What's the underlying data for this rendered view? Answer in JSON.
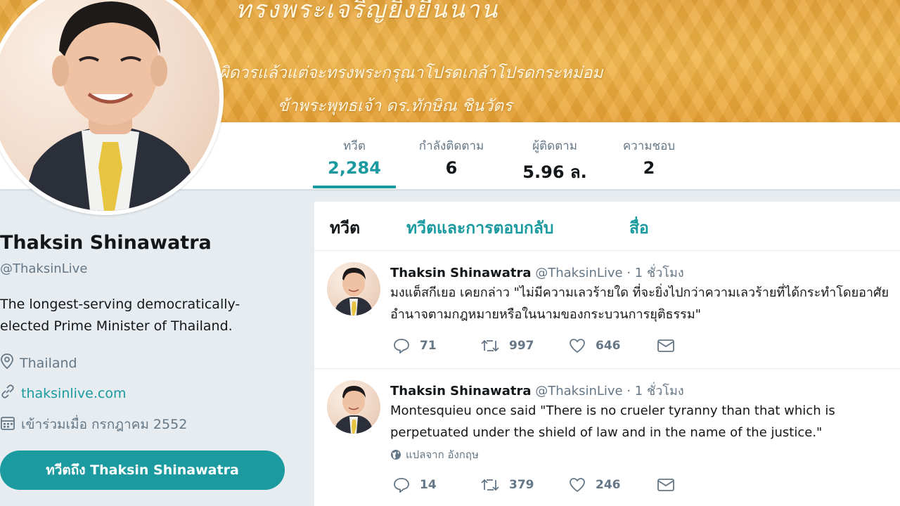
{
  "banner": {
    "line1": "ทรงพระเจริญยิ่งยืนนาน",
    "line2": "ผิดวรแล้วแต่จะทรงพระกรุณาโปรดเกล้าโปรดกระหม่อม",
    "line3": "ข้าพระพุทธเจ้า ดร.ทักษิณ ชินวัตร"
  },
  "stats": [
    {
      "label": "ทวีต",
      "value": "2,284"
    },
    {
      "label": "กำลังติดตาม",
      "value": "6"
    },
    {
      "label": "ผู้ติดตาม",
      "value": "5.96 ล."
    },
    {
      "label": "ความชอบ",
      "value": "2"
    }
  ],
  "profile": {
    "name": "Thaksin Shinawatra",
    "handle": "@ThaksinLive",
    "bio": "The longest-serving democratically-elected Prime Minister of Thailand.",
    "location": "Thailand",
    "website": "thaksinlive.com",
    "joined": "เข้าร่วมเมื่อ กรกฎาคม 2552",
    "tweet_to_button": "ทวีตถึง Thaksin Shinawatra"
  },
  "tabs": {
    "tweets": "ทวีต",
    "tweets_replies": "ทวีตและการตอบกลับ",
    "media": "สื่อ"
  },
  "tweets": [
    {
      "name": "Thaksin Shinawatra",
      "meta": "@ThaksinLive · 1 ชั่วโมง",
      "text": "มงแต็สกีเยอ เคยกล่าว \"ไม่มีความเลวร้ายใด ที่จะยิ่งไปกว่าความเลวร้ายที่ได้กระทำโดยอาศัยอำนาจตามกฎหมายหรือในนามของกระบวนการยุติธรรม\"",
      "replies": "71",
      "retweets": "997",
      "likes": "646"
    },
    {
      "name": "Thaksin Shinawatra",
      "meta": "@ThaksinLive · 1 ชั่วโมง",
      "text": "Montesquieu once said \"There is no crueler tyranny than that which is perpetuated under the shield of law and in the name of the justice.\"",
      "translate": "แปลจาก อังกฤษ",
      "replies": "14",
      "retweets": "379",
      "likes": "246"
    }
  ],
  "colors": {
    "accent": "#1b9a9f",
    "banner": "#f0b548",
    "muted": "#657786"
  }
}
